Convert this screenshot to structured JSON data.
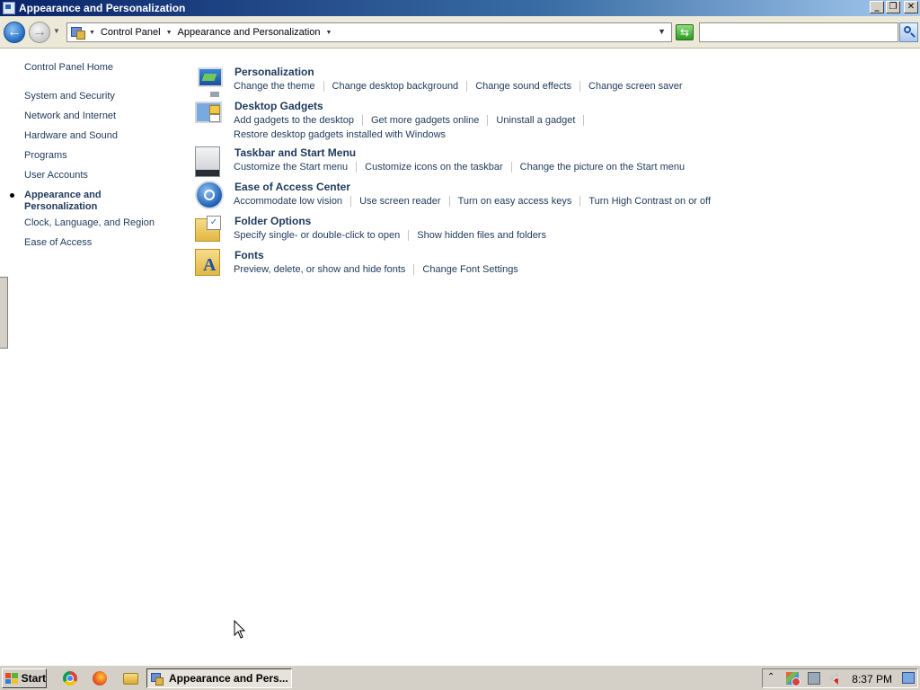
{
  "window": {
    "title": "Appearance and Personalization",
    "controls": {
      "minimize": "_",
      "maximize": "❐",
      "close": "✕"
    }
  },
  "addressbar": {
    "back_icon": "back-arrow-icon",
    "forward_icon": "forward-arrow-icon",
    "breadcrumbs": [
      "Control Panel",
      "Appearance and Personalization"
    ],
    "search_value": "",
    "search_placeholder": ""
  },
  "sidebar": {
    "home": "Control Panel Home",
    "items": [
      {
        "label": "System and Security"
      },
      {
        "label": "Network and Internet"
      },
      {
        "label": "Hardware and Sound"
      },
      {
        "label": "Programs"
      },
      {
        "label": "User Accounts"
      },
      {
        "label": "Appearance and\nPersonalization",
        "current": true
      },
      {
        "label": "Clock, Language, and Region"
      },
      {
        "label": "Ease of Access"
      }
    ]
  },
  "sections": [
    {
      "icon": "personalization-icon",
      "title": "Personalization",
      "tasks": [
        "Change the theme",
        "Change desktop background",
        "Change sound effects",
        "Change screen saver"
      ]
    },
    {
      "icon": "desktop-gadgets-icon",
      "title": "Desktop Gadgets",
      "tasks": [
        "Add gadgets to the desktop",
        "Get more gadgets online",
        "Uninstall a gadget"
      ],
      "tasks_line2": [
        "Restore desktop gadgets installed with Windows"
      ]
    },
    {
      "icon": "taskbar-start-menu-icon",
      "title": "Taskbar and Start Menu",
      "tasks": [
        "Customize the Start menu",
        "Customize icons on the taskbar",
        "Change the picture on the Start menu"
      ]
    },
    {
      "icon": "ease-of-access-icon",
      "title": "Ease of Access Center",
      "tasks": [
        "Accommodate low vision",
        "Use screen reader",
        "Turn on easy access keys",
        "Turn High Contrast on or off"
      ]
    },
    {
      "icon": "folder-options-icon",
      "title": "Folder Options",
      "tasks": [
        "Specify single- or double-click to open",
        "Show hidden files and folders"
      ]
    },
    {
      "icon": "fonts-icon",
      "title": "Fonts",
      "tasks": [
        "Preview, delete, or show and hide fonts",
        "Change Font Settings"
      ]
    }
  ],
  "taskbar": {
    "start_label": "Start",
    "quick_launch": [
      "chrome-icon",
      "firefox-icon",
      "explorer-icon"
    ],
    "active_window": "Appearance and Pers...",
    "tray_arrow": "⌃",
    "clock": "8:37 PM"
  }
}
